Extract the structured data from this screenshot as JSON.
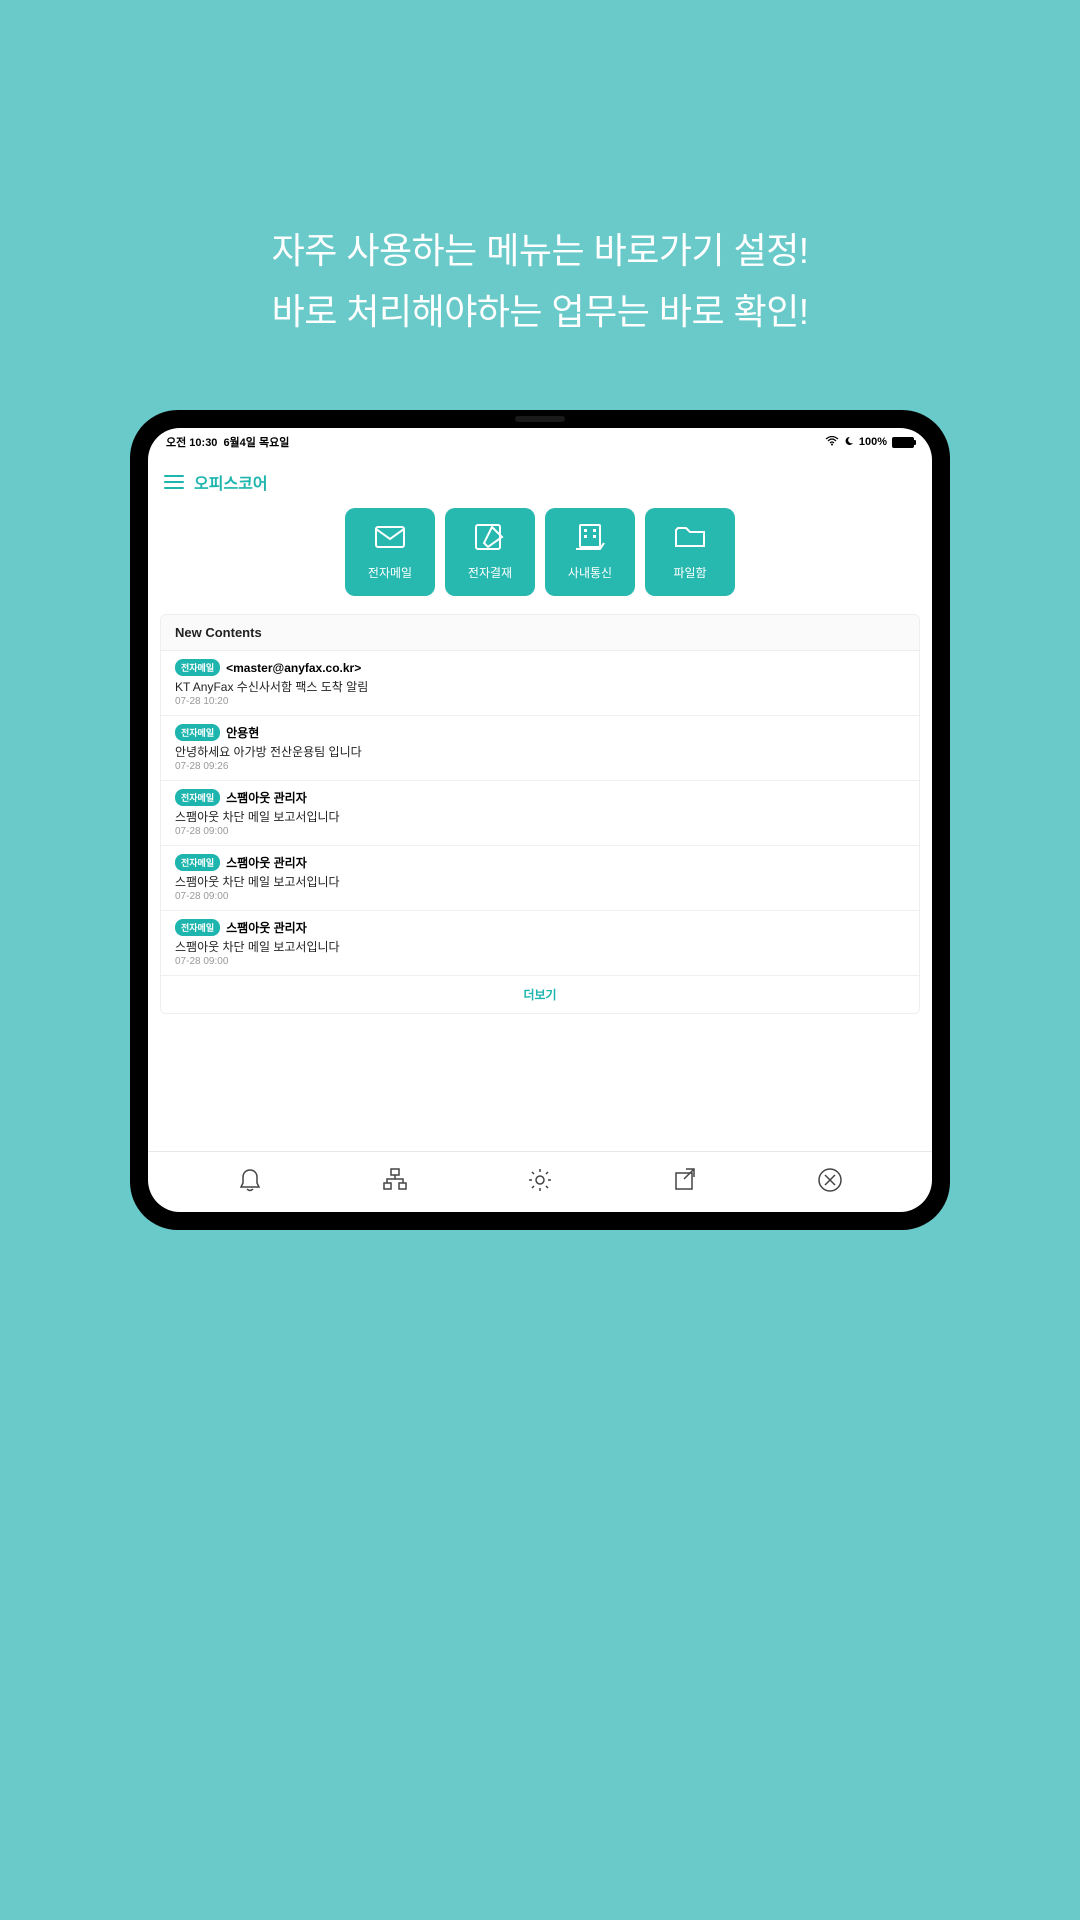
{
  "promo": {
    "line1_prefix": "자주 사용하는 메뉴는 ",
    "line1_bold": "바로가기 설정!",
    "line2_prefix": "바로 처리해야하는 업무는 ",
    "line2_bold": "바로 확인!"
  },
  "status": {
    "time": "오전 10:30",
    "date": "6월4일 목요일",
    "battery_pct": "100%"
  },
  "app": {
    "title": "오피스코어"
  },
  "shortcuts": [
    {
      "label": "전자메일"
    },
    {
      "label": "전자결재"
    },
    {
      "label": "사내통신"
    },
    {
      "label": "파일함"
    }
  ],
  "contents": {
    "header": "New Contents",
    "more_label": "더보기",
    "items": [
      {
        "badge": "전자메일",
        "sender": "<master@anyfax.co.kr>",
        "subject": "KT AnyFax 수신사서함 팩스 도착 알림",
        "time": "07-28 10:20"
      },
      {
        "badge": "전자메일",
        "sender": "안용현",
        "subject": "안녕하세요 아가방 전산운용팀 입니다",
        "time": "07-28 09:26"
      },
      {
        "badge": "전자메일",
        "sender": "스팸아웃 관리자",
        "subject": "스팸아웃 차단 메일 보고서입니다",
        "time": "07-28 09:00"
      },
      {
        "badge": "전자메일",
        "sender": "스팸아웃 관리자",
        "subject": "스팸아웃 차단 메일 보고서입니다",
        "time": "07-28 09:00"
      },
      {
        "badge": "전자메일",
        "sender": "스팸아웃 관리자",
        "subject": "스팸아웃 차단 메일 보고서입니다",
        "time": "07-28 09:00"
      }
    ]
  }
}
